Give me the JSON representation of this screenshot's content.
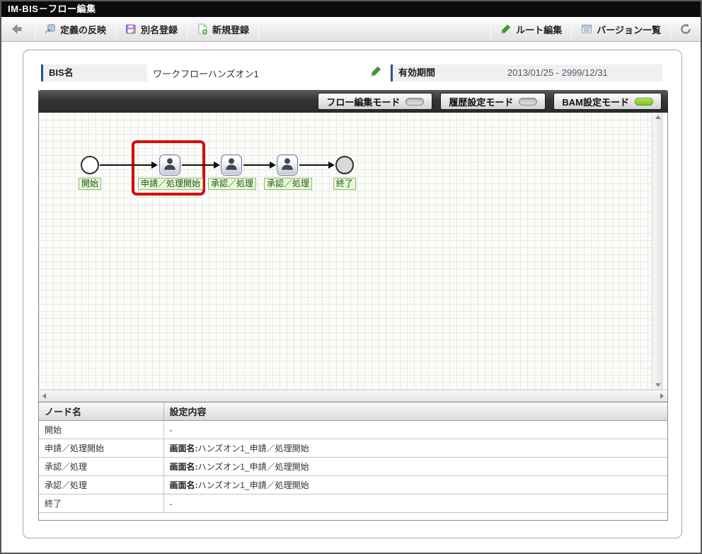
{
  "window": {
    "title": "IM-BIS－フロー編集"
  },
  "toolbar": {
    "back_icon": "back-arrow-icon",
    "left_buttons": [
      {
        "label": "定義の反映",
        "icon": "database-sync-icon"
      },
      {
        "label": "別名登録",
        "icon": "save-alias-icon"
      },
      {
        "label": "新規登録",
        "icon": "new-document-icon"
      }
    ],
    "right_buttons": [
      {
        "label": "ルート編集",
        "icon": "green-pencil-icon"
      },
      {
        "label": "バージョン一覧",
        "icon": "version-list-icon"
      }
    ],
    "refresh_icon": "refresh-icon"
  },
  "fields": {
    "bis_name_label": "BIS名",
    "bis_name_value": "ワークフローハンズオン1",
    "period_label": "有効期間",
    "period_value": "2013/01/25 - 2999/12/31"
  },
  "mode_bar": {
    "modes": [
      {
        "label": "フロー編集モード",
        "active": false
      },
      {
        "label": "履歴設定モード",
        "active": false
      },
      {
        "label": "BAM設定モード",
        "active": true
      }
    ]
  },
  "flow": {
    "nodes": [
      {
        "type": "start",
        "label": "開始"
      },
      {
        "type": "task",
        "label": "申請／処理開始",
        "highlighted": true
      },
      {
        "type": "task",
        "label": "承認／処理"
      },
      {
        "type": "task",
        "label": "承認／処理"
      },
      {
        "type": "end",
        "label": "終了"
      }
    ]
  },
  "table": {
    "headers": [
      "ノード名",
      "設定内容"
    ],
    "rows": [
      {
        "name": "開始",
        "setting_label": "",
        "setting_value": "-"
      },
      {
        "name": "申請／処理開始",
        "setting_label": "画面名:",
        "setting_value": "ハンズオン1_申請／処理開始"
      },
      {
        "name": "承認／処理",
        "setting_label": "画面名:",
        "setting_value": "ハンズオン1_申請／処理開始"
      },
      {
        "name": "承認／処理",
        "setting_label": "画面名:",
        "setting_value": "ハンズオン1_申請／処理開始"
      },
      {
        "name": "終了",
        "setting_label": "",
        "setting_value": "-"
      }
    ]
  },
  "colors": {
    "toggle_active_green": "#7cc823",
    "highlight_red": "#dc0a0a",
    "node_label_bg": "#ebf7d8",
    "node_label_border": "#93b477",
    "node_label_text": "#17591b",
    "field_accent_blue": "#26519c",
    "title_bar_bg": "#0b0b0b"
  }
}
